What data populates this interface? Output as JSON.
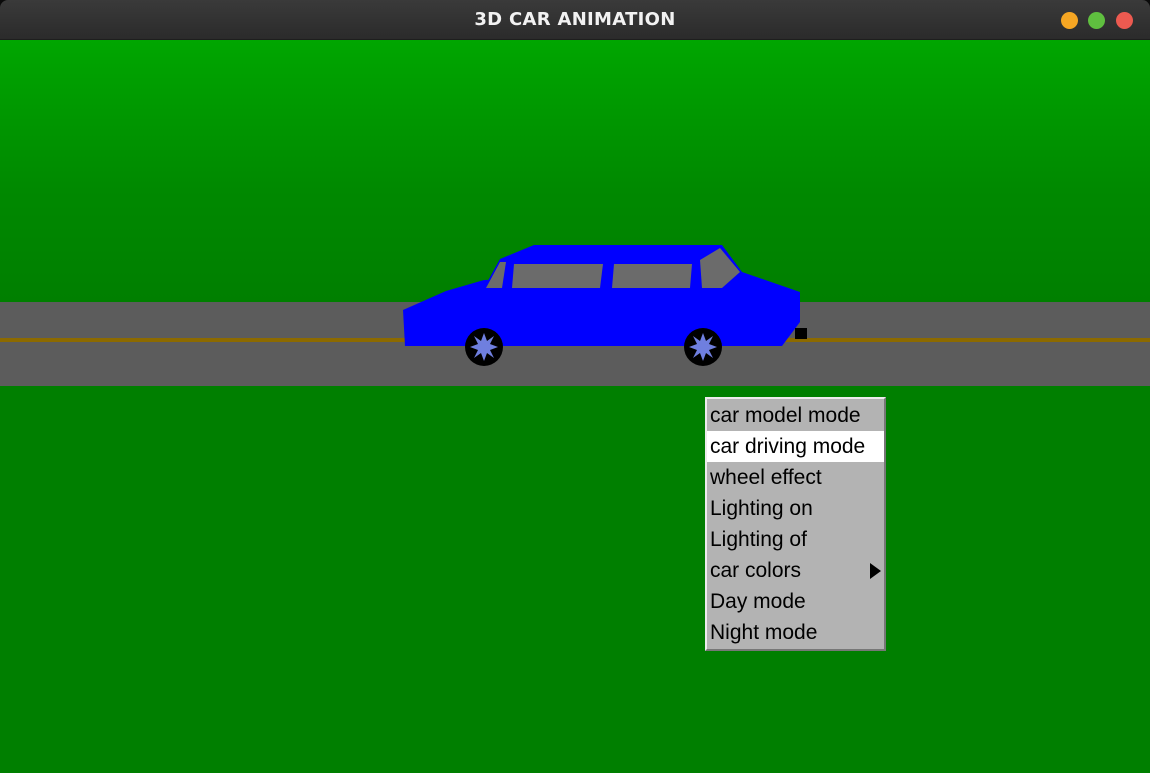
{
  "window": {
    "title": "3D CAR ANIMATION",
    "controls": [
      {
        "name": "minimize",
        "color": "#f5a623"
      },
      {
        "name": "maximize",
        "color": "#5fbf3f"
      },
      {
        "name": "close",
        "color": "#ec5a50"
      }
    ]
  },
  "scene": {
    "sky_color": "#00a600",
    "ground_color": "#007f00",
    "road_color": "#5c5c5c",
    "road_line_color": "#8c6a00",
    "car": {
      "body_color": "#0000ff",
      "window_color": "#6b6b6b",
      "tire_color": "#000000",
      "hubcap_color": "#6f7fdf"
    }
  },
  "context_menu": {
    "items": [
      {
        "label": "car model mode",
        "highlighted": false,
        "submenu": false
      },
      {
        "label": "car driving mode",
        "highlighted": true,
        "submenu": false
      },
      {
        "label": "wheel effect",
        "highlighted": false,
        "submenu": false
      },
      {
        "label": "Lighting on",
        "highlighted": false,
        "submenu": false
      },
      {
        "label": "Lighting of",
        "highlighted": false,
        "submenu": false
      },
      {
        "label": "car colors",
        "highlighted": false,
        "submenu": true
      },
      {
        "label": "Day mode",
        "highlighted": false,
        "submenu": false
      },
      {
        "label": "Night mode",
        "highlighted": false,
        "submenu": false
      }
    ]
  }
}
